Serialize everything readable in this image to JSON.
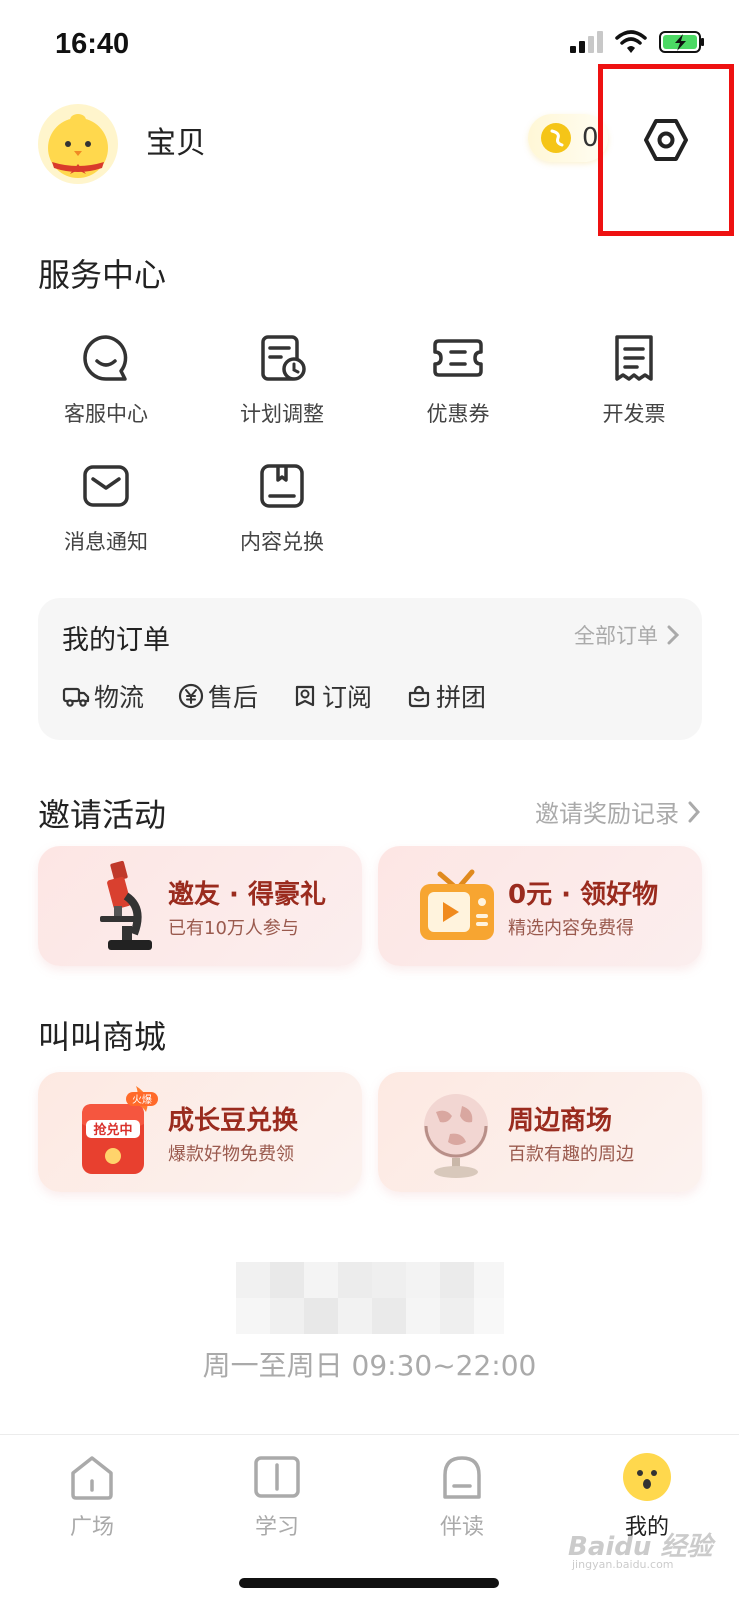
{
  "status_bar": {
    "time": "16:40"
  },
  "header": {
    "username": "宝贝",
    "coin_count": "0"
  },
  "service_center": {
    "title": "服务中心",
    "items": [
      {
        "label": "客服中心",
        "icon": "chat-icon"
      },
      {
        "label": "计划调整",
        "icon": "plan-icon"
      },
      {
        "label": "优惠券",
        "icon": "coupon-icon"
      },
      {
        "label": "开发票",
        "icon": "invoice-icon"
      },
      {
        "label": "消息通知",
        "icon": "mail-icon"
      },
      {
        "label": "内容兑换",
        "icon": "redeem-icon"
      }
    ]
  },
  "orders": {
    "title": "我的订单",
    "all_label": "全部订单",
    "items": [
      {
        "label": "物流",
        "icon": "truck-icon"
      },
      {
        "label": "售后",
        "icon": "yen-icon"
      },
      {
        "label": "订阅",
        "icon": "subscribe-icon"
      },
      {
        "label": "拼团",
        "icon": "group-icon"
      }
    ]
  },
  "invite": {
    "title": "邀请活动",
    "link_label": "邀请奖励记录",
    "cards": [
      {
        "title": "邀友 · 得豪礼",
        "subtitle": "已有10万人参与",
        "icon": "microscope-icon"
      },
      {
        "title": "0元 · 领好物",
        "subtitle": "精选内容免费得",
        "icon": "tv-icon"
      }
    ]
  },
  "shop": {
    "title": "叫叫商城",
    "cards": [
      {
        "title": "成长豆兑换",
        "subtitle": "爆款好物免费领",
        "icon": "red-envelope-icon",
        "badge": "抢兑中",
        "tag": "火爆"
      },
      {
        "title": "周边商场",
        "subtitle": "百款有趣的周边",
        "icon": "globe-icon"
      }
    ]
  },
  "service_hours": "周一至周日 09:30~22:00",
  "tab_bar": {
    "tabs": [
      {
        "label": "广场",
        "icon": "home-icon",
        "active": false
      },
      {
        "label": "学习",
        "icon": "book-icon",
        "active": false
      },
      {
        "label": "伴读",
        "icon": "companion-icon",
        "active": false
      },
      {
        "label": "我的",
        "icon": "profile-face-icon",
        "active": true
      }
    ]
  },
  "watermark": {
    "text": "Baidu 经验",
    "sub": "jingyan.baidu.com"
  },
  "colors": {
    "accent_yellow": "#ffd84d",
    "highlight_red": "#ee1111",
    "promo_title": "#9a2b1e"
  }
}
